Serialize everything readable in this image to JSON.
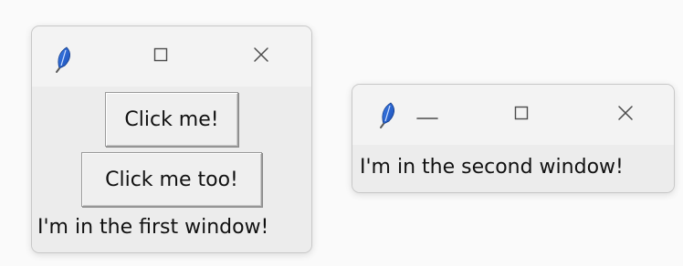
{
  "windows": [
    {
      "title_icon": "feather-icon",
      "controls": {
        "maximize_icon": "square-icon",
        "close_icon": "close-icon"
      },
      "buttons": [
        {
          "label": "Click me!"
        },
        {
          "label": "Click me too!"
        }
      ],
      "label": "I'm in the first window!"
    },
    {
      "title_icon": "feather-icon",
      "controls": {
        "minimize_icon": "minus-icon",
        "maximize_icon": "square-icon",
        "close_icon": "close-icon"
      },
      "label": "I'm in the second window!"
    }
  ]
}
